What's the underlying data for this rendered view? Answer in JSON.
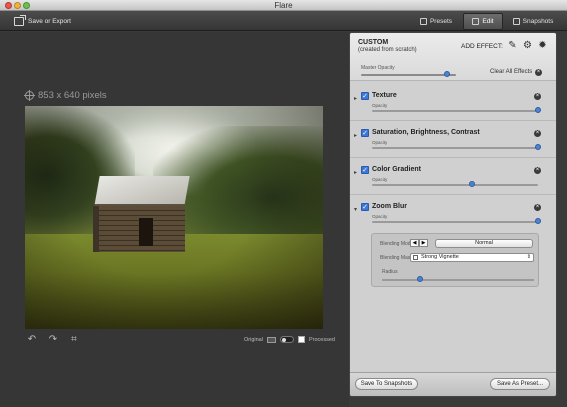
{
  "window": {
    "title": "Flare"
  },
  "toolbar": {
    "export_label": "Save or Export",
    "tabs": [
      {
        "label": "Presets",
        "icon": "presets-icon"
      },
      {
        "label": "Edit",
        "icon": "edit-icon",
        "selected": true
      },
      {
        "label": "Snapshots",
        "icon": "snapshots-icon"
      }
    ]
  },
  "canvas": {
    "dimensions": "853 x 640 pixels",
    "compare": {
      "original_label": "Original",
      "processed_label": "Processed"
    }
  },
  "panel": {
    "title": "CUSTOM",
    "subtitle": "(created from scratch)",
    "add_effect_label": "ADD EFFECT:",
    "master_opacity_label": "Master Opacity",
    "master_opacity_value": 0.9,
    "clear_all_label": "Clear All Effects",
    "effects": [
      {
        "name": "Texture",
        "opacity_label": "Opacity",
        "opacity": 1.0,
        "enabled": true
      },
      {
        "name": "Saturation, Brightness, Contrast",
        "opacity_label": "Opacity",
        "opacity": 1.0,
        "enabled": true
      },
      {
        "name": "Color Gradient",
        "opacity_label": "Opacity",
        "opacity": 0.6,
        "enabled": true
      },
      {
        "name": "Zoom Blur",
        "opacity_label": "Opacity",
        "opacity": 1.0,
        "enabled": true
      }
    ],
    "zoom_blur": {
      "blending_mode_label": "Blending Mode",
      "blending_mode_value": "Normal",
      "blur_mask_label": "Blending Mask",
      "blur_mask_value": "Strong Vignette",
      "radius_label": "Radius",
      "radius_value": 0.25
    },
    "footer": {
      "save_snapshots_label": "Save To Snapshots",
      "save_preset_label": "Save As Preset..."
    }
  },
  "colors": {
    "accent": "#4b84d6",
    "canvas_bg": "#363636",
    "panel_bg": "#d0d0d0"
  }
}
